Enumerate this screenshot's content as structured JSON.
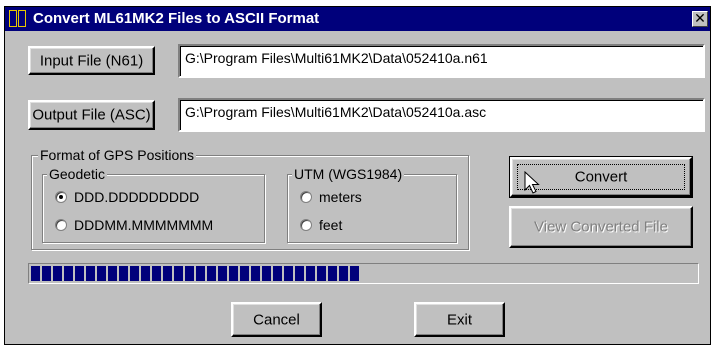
{
  "window": {
    "title": "Convert ML61MK2 Files to ASCII Format"
  },
  "input_file": {
    "button_label": "Input File (N61)",
    "value": "G:\\Program Files\\Multi61MK2\\Data\\052410a.n61"
  },
  "output_file": {
    "button_label": "Output File (ASC)",
    "value": "G:\\Program Files\\Multi61MK2\\Data\\052410a.asc"
  },
  "gps_format": {
    "title": "Format of GPS Positions",
    "geodetic": {
      "title": "Geodetic",
      "options": [
        "DDD.DDDDDDDDD",
        "DDDMM.MMMMMMM"
      ],
      "selected": "DDD.DDDDDDDDD"
    },
    "utm": {
      "title": "UTM (WGS1984)",
      "options": [
        "meters",
        "feet"
      ],
      "selected": null
    }
  },
  "buttons": {
    "convert": "Convert",
    "view_converted": "View Converted File",
    "cancel": "Cancel",
    "exit": "Exit"
  },
  "progress": {
    "fraction": 0.51,
    "color": "#00007b"
  }
}
